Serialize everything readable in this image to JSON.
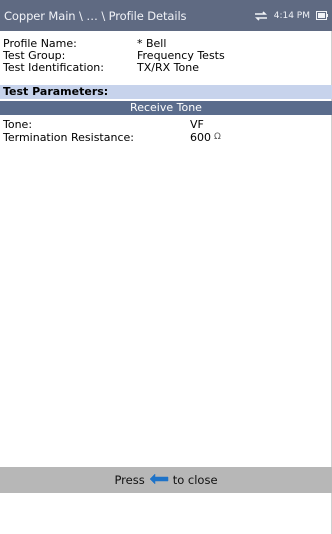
{
  "header": {
    "title": "Copper Main \\ … \\ Profile Details",
    "time": "4:14 PM",
    "icons": [
      "usb-connection-icon",
      "battery-icon"
    ]
  },
  "profile": {
    "rows": [
      {
        "label": "Profile Name:",
        "value": "* Bell"
      },
      {
        "label": "Test Group:",
        "value": "Frequency Tests"
      },
      {
        "label": "Test Identification:",
        "value": "TX/RX Tone"
      }
    ]
  },
  "test_parameters": {
    "title": "Test Parameters:",
    "subsection": "Receive Tone",
    "params": [
      {
        "label": "Tone:",
        "value": "VF",
        "unit": ""
      },
      {
        "label": "Termination Resistance:",
        "value": "600",
        "unit": "Ω"
      }
    ]
  },
  "footer": {
    "press_label": "Press",
    "close_label": "to close",
    "icon": "back-arrow-icon"
  },
  "colors": {
    "header_bg": "#5f6a82",
    "section_bg": "#c7d3ec",
    "subsection_bg": "#5a6c8c",
    "footer_bg": "#b7b7b7",
    "arrow_blue": "#1e73c8"
  }
}
